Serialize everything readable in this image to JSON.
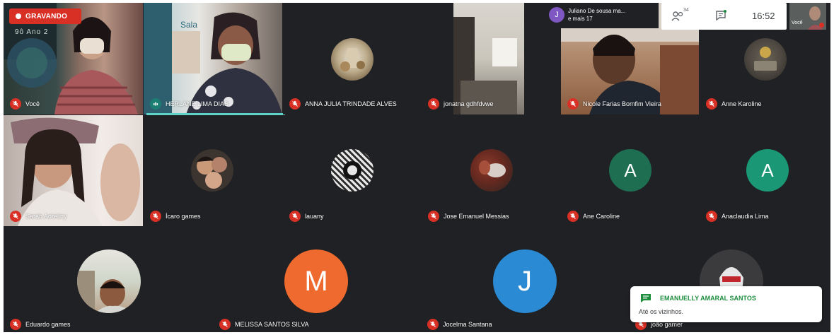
{
  "recording": {
    "label": "GRAVANDO"
  },
  "header": {
    "people_chip": {
      "avatar_letter": "J",
      "line1": "Juliano De sousa ma...",
      "line2": "e mais 17"
    },
    "participants_count": "34",
    "clock": "16:52",
    "self_label": "Você"
  },
  "participants": [
    {
      "name": "Você",
      "kind": "video"
    },
    {
      "name": "HERLANE LIMA DIAS",
      "kind": "video"
    },
    {
      "name": "ANNA JULIA TRINDADE ALVES",
      "kind": "photo"
    },
    {
      "name": "jonatna gdhfdvwe",
      "kind": "video"
    },
    {
      "name": "Nicole Farias Bomfim Vieira",
      "kind": "video"
    },
    {
      "name": "Anne Karoline",
      "kind": "photo"
    },
    {
      "name": "Sarah Adreliny",
      "kind": "video"
    },
    {
      "name": "Ícaro games",
      "kind": "photo"
    },
    {
      "name": "lauany",
      "kind": "photo"
    },
    {
      "name": "Jose Emanuel Messias",
      "kind": "photo"
    },
    {
      "name": "Ane Caroline",
      "kind": "letter",
      "letter": "A",
      "color": "#1e6e52"
    },
    {
      "name": "Anaclaudia Lima",
      "kind": "letter",
      "letter": "A",
      "color": "#1a9876"
    },
    {
      "name": "Eduardo games",
      "kind": "photo"
    },
    {
      "name": "MELISSA SANTOS SILVA",
      "kind": "letter",
      "letter": "M",
      "color": "#ef6a2e"
    },
    {
      "name": "Jocelma Santana",
      "kind": "letter",
      "letter": "J",
      "color": "#2a8ad4"
    },
    {
      "name": "joão gamer",
      "kind": "photo"
    }
  ],
  "video_text": {
    "board_text": "9ô Ano 2",
    "sala_text": "Sala"
  },
  "chat_popup": {
    "sender": "EMANUELLY AMARAL SANTOS",
    "message": "Até os vizinhos."
  },
  "colors": {
    "background": "#202124",
    "mute_red": "#d93025",
    "speaking": "#5fd3c8",
    "chat_sender": "#1e8e3e"
  }
}
